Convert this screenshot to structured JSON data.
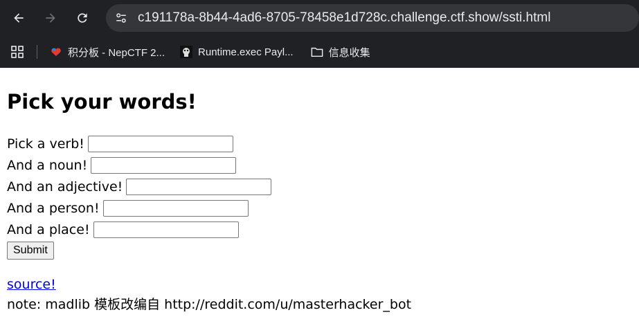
{
  "browser": {
    "url": "c191178a-8b44-4ad6-8705-78458e1d728c.challenge.ctf.show/ssti.html",
    "bookmarks": [
      {
        "label": "积分板 - NepCTF 2...",
        "icon": "heart-flag-icon"
      },
      {
        "label": "Runtime.exec Payl...",
        "icon": "bookmark-favicon"
      },
      {
        "label": "信息收集",
        "icon": "folder-icon"
      }
    ]
  },
  "page": {
    "title": "Pick your words!",
    "fields": [
      {
        "label": "Pick a verb!",
        "value": ""
      },
      {
        "label": "And a noun!",
        "value": ""
      },
      {
        "label": "And an adjective!",
        "value": ""
      },
      {
        "label": "And a person!",
        "value": ""
      },
      {
        "label": "And a place!",
        "value": ""
      }
    ],
    "submit_label": "Submit",
    "source_link": "source!",
    "note": "note: madlib 模板改编自 http://reddit.com/u/masterhacker_bot"
  },
  "colors": {
    "chrome_bg": "#202124",
    "omnibox_bg": "#35363a",
    "link": "#0000ee"
  }
}
